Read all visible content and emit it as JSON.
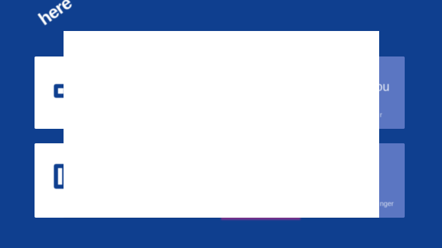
{
  "brand": {
    "logo_text": "here"
  },
  "tiles": {
    "right_top": {
      "label": "ou",
      "sub": "r"
    },
    "right_bottom": {
      "label": "",
      "sub": "nger"
    }
  },
  "modal": {},
  "colors": {
    "background": "#0f3f8f",
    "tile_white": "#ffffff",
    "tile_accent": "#5b76c2",
    "bottom_accent": "#9b2f90"
  },
  "icons": [
    "tile-icon-1",
    "tile-icon-2"
  ]
}
